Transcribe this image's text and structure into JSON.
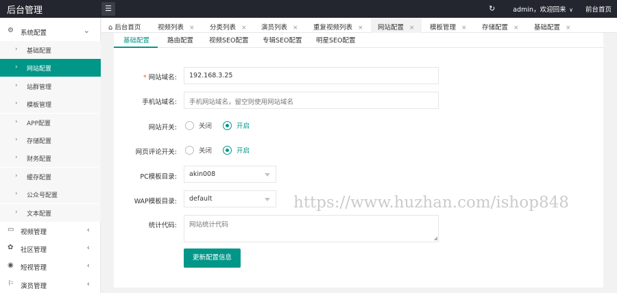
{
  "header": {
    "logo": "后台管理",
    "menu_toggle_icon": "menu-toggle-icon",
    "refresh_icon": "refresh-icon",
    "user_text": "admin，欢迎回来",
    "front_link": "前台首页"
  },
  "sidebar": {
    "groups": [
      {
        "label": "系统配置",
        "icon": "settings-icon"
      },
      {
        "label": "视频管理",
        "icon": "video-icon"
      },
      {
        "label": "社区管理",
        "icon": "community-icon"
      },
      {
        "label": "短视管理",
        "icon": "play-icon"
      },
      {
        "label": "演员管理",
        "icon": "flag-icon"
      }
    ],
    "items": [
      {
        "label": "基础配置"
      },
      {
        "label": "网站配置"
      },
      {
        "label": "站群管理"
      },
      {
        "label": "模板管理"
      },
      {
        "label": "APP配置"
      },
      {
        "label": "存储配置"
      },
      {
        "label": "财务配置"
      },
      {
        "label": "缓存配置"
      },
      {
        "label": "公众号配置"
      },
      {
        "label": "文本配置"
      }
    ],
    "active_item": "网站配置"
  },
  "tabs": [
    {
      "label": "后台首页"
    },
    {
      "label": "视频列表"
    },
    {
      "label": "分类列表"
    },
    {
      "label": "演员列表"
    },
    {
      "label": "重复视频列表"
    },
    {
      "label": "网站配置"
    },
    {
      "label": "模板管理"
    },
    {
      "label": "存储配置"
    },
    {
      "label": "基础配置"
    }
  ],
  "subtabs": [
    {
      "label": "基础配置"
    },
    {
      "label": "路由配置"
    },
    {
      "label": "视频SEO配置"
    },
    {
      "label": "专辑SEO配置"
    },
    {
      "label": "明星SEO配置"
    }
  ],
  "form": {
    "domain": {
      "label": "网站域名:",
      "required_mark": "*",
      "value": "192.168.3.25"
    },
    "mobile_domain": {
      "label": "手机站域名:",
      "placeholder": "手机网站域名，留空则使用网站域名"
    },
    "site_switch": {
      "label": "网站开关:",
      "off": "关闭",
      "on": "开启",
      "selected": "开启"
    },
    "comment_switch": {
      "label": "网页评论开关:",
      "off": "关闭",
      "on": "开启",
      "selected": "开启"
    },
    "pc_template": {
      "label": "PC模板目录:",
      "value": "akin008"
    },
    "wap_template": {
      "label": "WAP模板目录:",
      "value": "default"
    },
    "stats_code": {
      "label": "统计代码:",
      "placeholder": "网站统计代码"
    },
    "submit": "更新配置信息"
  },
  "watermark": "https://www.huzhan.com/ishop848",
  "colors": {
    "accent": "#009688",
    "topbar": "#23262e",
    "required": "#ff5722"
  }
}
